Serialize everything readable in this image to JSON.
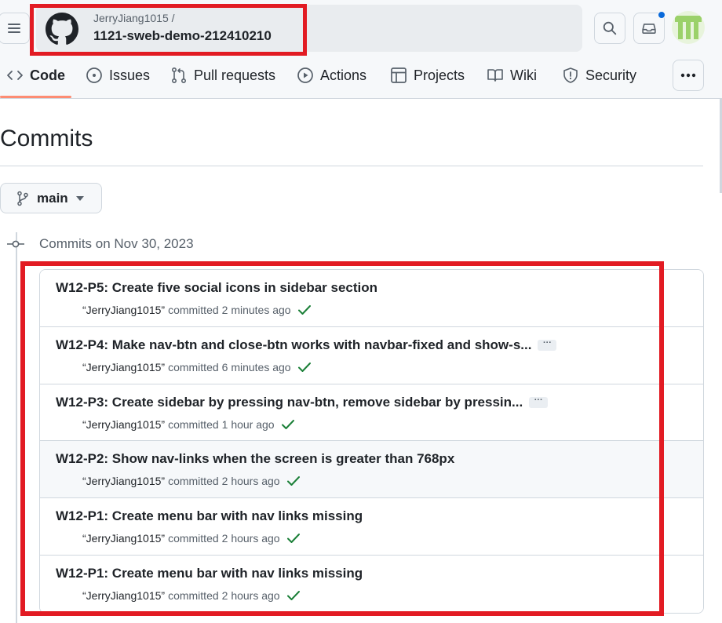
{
  "repo": {
    "owner": "JerryJiang1015 /",
    "name": "1121-sweb-demo-212410210"
  },
  "tabs": [
    {
      "label": "Code"
    },
    {
      "label": "Issues"
    },
    {
      "label": "Pull requests"
    },
    {
      "label": "Actions"
    },
    {
      "label": "Projects"
    },
    {
      "label": "Wiki"
    },
    {
      "label": "Security"
    }
  ],
  "page": {
    "title": "Commits",
    "branch": "main",
    "date_heading": "Commits on Nov 30, 2023"
  },
  "commits": [
    {
      "message": "W12-P5: Create five social icons in sidebar section",
      "author": "“JerryJiang1015”",
      "verb": "committed",
      "time": "2 minutes ago",
      "truncated": false
    },
    {
      "message": "W12-P4: Make nav-btn and close-btn works with navbar-fixed and show-s...",
      "author": "“JerryJiang1015”",
      "verb": "committed",
      "time": "6 minutes ago",
      "truncated": true,
      "more": "···"
    },
    {
      "message": "W12-P3: Create sidebar by pressing nav-btn, remove sidebar by pressin...",
      "author": "“JerryJiang1015”",
      "verb": "committed",
      "time": "1 hour ago",
      "truncated": true,
      "more": "···"
    },
    {
      "message": "W12-P2: Show nav-links when the screen is greater than 768px",
      "author": "“JerryJiang1015”",
      "verb": "committed",
      "time": "2 hours ago",
      "truncated": false
    },
    {
      "message": "W12-P1: Create menu bar with nav links missing",
      "author": "“JerryJiang1015”",
      "verb": "committed",
      "time": "2 hours ago",
      "truncated": false
    },
    {
      "message": "W12-P1: Create menu bar with nav links missing",
      "author": "“JerryJiang1015”",
      "verb": "committed",
      "time": "2 hours ago",
      "truncated": false
    }
  ],
  "icons": {
    "menu": "hamburger-icon",
    "logo": "github-mark-icon",
    "search": "search-icon",
    "inbox": "inbox-icon",
    "more": "kebab-horizontal-icon",
    "branch": "git-branch-icon",
    "check": "check-icon"
  },
  "colors": {
    "highlight": "#e21b23",
    "check": "#1a7f37",
    "tab_underline": "#fd8c73",
    "notification": "#0969da"
  }
}
